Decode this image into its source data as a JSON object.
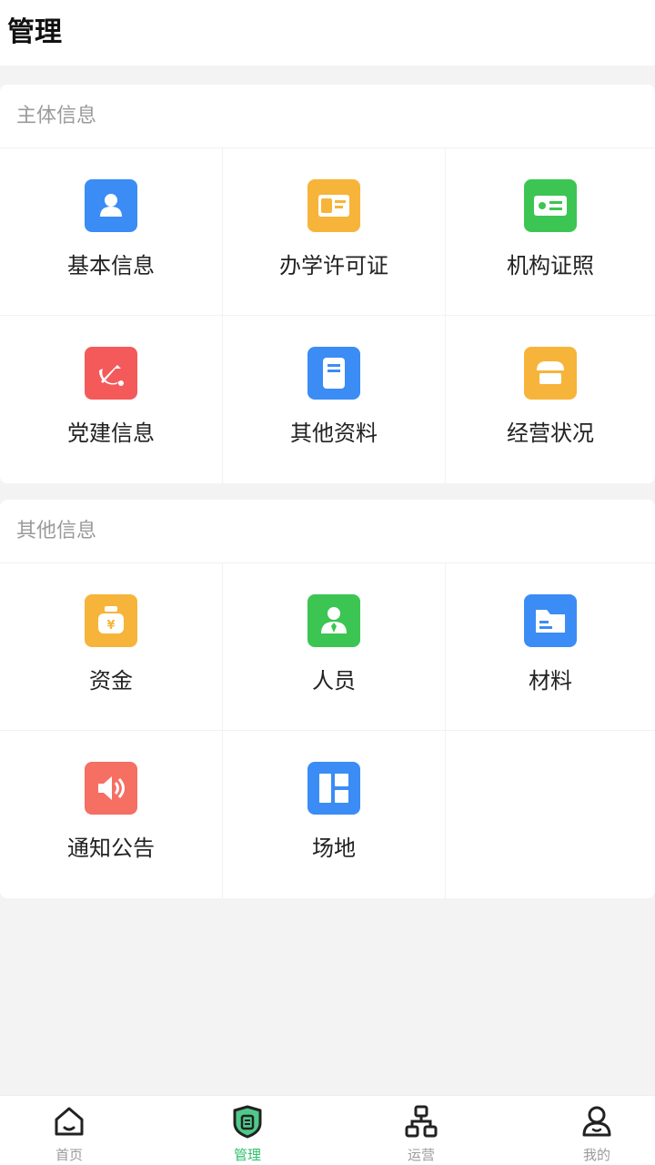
{
  "header": {
    "title": "管理"
  },
  "sections": [
    {
      "title": "主体信息",
      "items": [
        {
          "label": "基本信息",
          "icon": "person-card-icon",
          "color": "#3b8cf5"
        },
        {
          "label": "办学许可证",
          "icon": "license-icon",
          "color": "#f7b43a"
        },
        {
          "label": "机构证照",
          "icon": "id-card-icon",
          "color": "#3cc552"
        },
        {
          "label": "党建信息",
          "icon": "party-emblem-icon",
          "color": "#f45a5a"
        },
        {
          "label": "其他资料",
          "icon": "document-icon",
          "color": "#3b8cf5"
        },
        {
          "label": "经营状况",
          "icon": "shop-icon",
          "color": "#f7b43a"
        }
      ]
    },
    {
      "title": "其他信息",
      "items": [
        {
          "label": "资金",
          "icon": "money-bag-icon",
          "color": "#f7b43a"
        },
        {
          "label": "人员",
          "icon": "staff-icon",
          "color": "#3cc552"
        },
        {
          "label": "材料",
          "icon": "folder-icon",
          "color": "#3b8cf5"
        },
        {
          "label": "通知公告",
          "icon": "speaker-icon",
          "color": "#f56f63"
        },
        {
          "label": "场地",
          "icon": "layout-icon",
          "color": "#3b8cf5"
        }
      ]
    }
  ],
  "tabbar": {
    "items": [
      {
        "label": "首页",
        "icon": "home-icon",
        "active": false
      },
      {
        "label": "管理",
        "icon": "shield-doc-icon",
        "active": true
      },
      {
        "label": "运营",
        "icon": "org-chart-icon",
        "active": false
      },
      {
        "label": "我的",
        "icon": "user-icon",
        "active": false
      }
    ],
    "active_color": "#2dbf69",
    "inactive_color": "#9a9a9a"
  }
}
